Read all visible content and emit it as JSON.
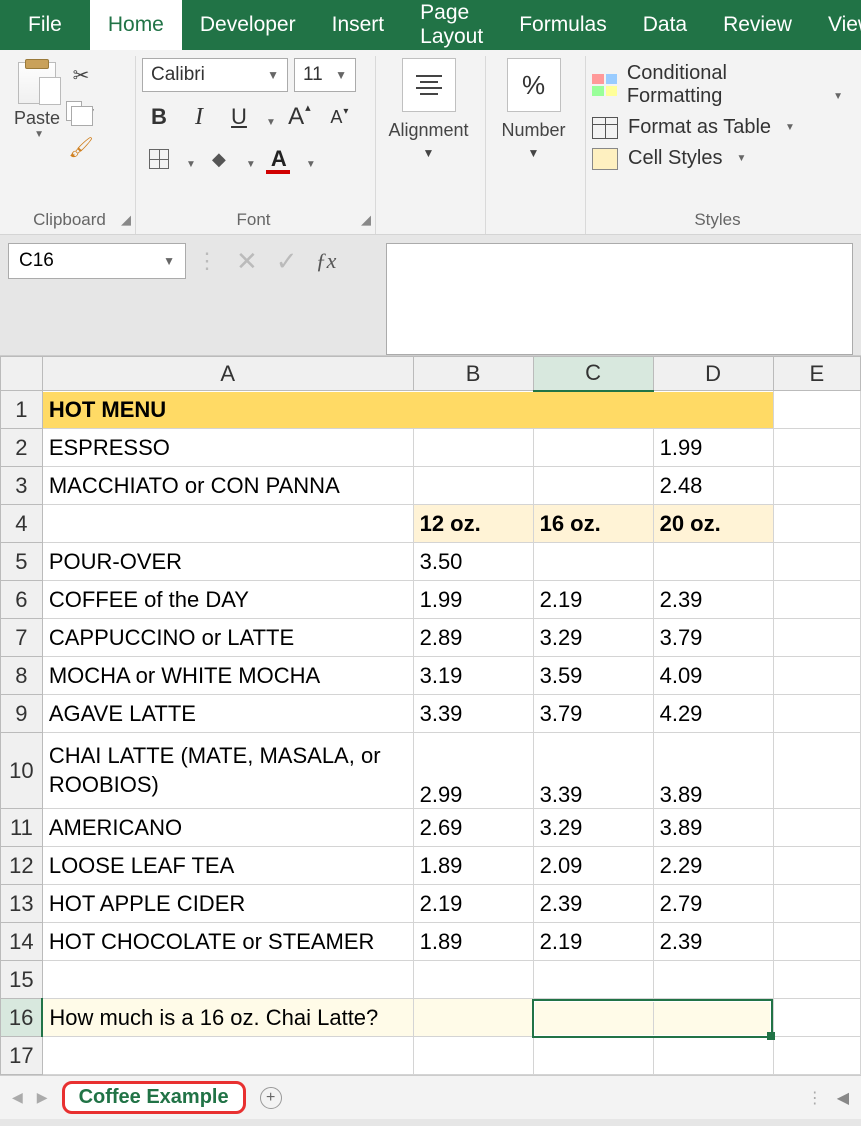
{
  "ribbon": {
    "tabs": [
      "File",
      "Home",
      "Developer",
      "Insert",
      "Page Layout",
      "Formulas",
      "Data",
      "Review",
      "View"
    ],
    "active": "Home",
    "groups": {
      "clipboard": {
        "label": "Clipboard",
        "paste": "Paste"
      },
      "font": {
        "label": "Font",
        "name": "Calibri",
        "size": "11",
        "bold": "B",
        "italic": "I",
        "underline": "U"
      },
      "alignment": {
        "label": "Alignment"
      },
      "number": {
        "label": "Number",
        "symbol": "%"
      },
      "styles": {
        "label": "Styles",
        "items": [
          "Conditional Formatting",
          "Format as Table",
          "Cell Styles"
        ]
      }
    }
  },
  "formula_bar": {
    "namebox": "C16",
    "formula": ""
  },
  "columns": [
    "A",
    "B",
    "C",
    "D",
    "E"
  ],
  "rows": [
    "1",
    "2",
    "3",
    "4",
    "5",
    "6",
    "7",
    "8",
    "9",
    "10",
    "11",
    "12",
    "13",
    "14",
    "15",
    "16",
    "17"
  ],
  "cells": {
    "title": "HOT MENU",
    "r2a": "ESPRESSO",
    "r2d": "1.99",
    "r3a": "MACCHIATO or CON PANNA",
    "r3d": "2.48",
    "r4b": "12 oz.",
    "r4c": "16 oz.",
    "r4d": "20 oz.",
    "r5a": "POUR-OVER",
    "r5b": "3.50",
    "r6a": "COFFEE of the DAY",
    "r6b": "1.99",
    "r6c": "2.19",
    "r6d": "2.39",
    "r7a": "CAPPUCCINO or LATTE",
    "r7b": "2.89",
    "r7c": "3.29",
    "r7d": "3.79",
    "r8a": "MOCHA or WHITE MOCHA",
    "r8b": "3.19",
    "r8c": "3.59",
    "r8d": "4.09",
    "r9a": "AGAVE LATTE",
    "r9b": "3.39",
    "r9c": "3.79",
    "r9d": "4.29",
    "r10a": "CHAI LATTE\n(MATE, MASALA, or ROOBIOS)",
    "r10b": "2.99",
    "r10c": "3.39",
    "r10d": "3.89",
    "r11a": "AMERICANO",
    "r11b": "2.69",
    "r11c": "3.29",
    "r11d": "3.89",
    "r12a": "LOOSE LEAF TEA",
    "r12b": "1.89",
    "r12c": "2.09",
    "r12d": "2.29",
    "r13a": "HOT APPLE CIDER",
    "r13b": "2.19",
    "r13c": "2.39",
    "r13d": "2.79",
    "r14a": "HOT CHOCOLATE or STEAMER",
    "r14b": "1.89",
    "r14c": "2.19",
    "r14d": "2.39",
    "question": "How much is a 16 oz. Chai Latte?"
  },
  "sheet_tab": "Coffee Example"
}
